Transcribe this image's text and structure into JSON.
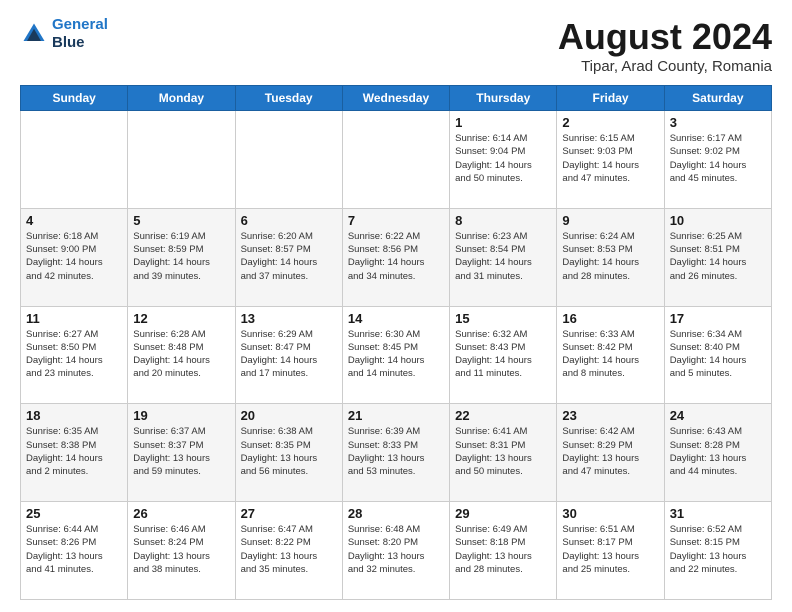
{
  "header": {
    "logo_line1": "General",
    "logo_line2": "Blue",
    "main_title": "August 2024",
    "subtitle": "Tipar, Arad County, Romania"
  },
  "weekdays": [
    "Sunday",
    "Monday",
    "Tuesday",
    "Wednesday",
    "Thursday",
    "Friday",
    "Saturday"
  ],
  "weeks": [
    [
      {
        "day": "",
        "info": ""
      },
      {
        "day": "",
        "info": ""
      },
      {
        "day": "",
        "info": ""
      },
      {
        "day": "",
        "info": ""
      },
      {
        "day": "1",
        "info": "Sunrise: 6:14 AM\nSunset: 9:04 PM\nDaylight: 14 hours\nand 50 minutes."
      },
      {
        "day": "2",
        "info": "Sunrise: 6:15 AM\nSunset: 9:03 PM\nDaylight: 14 hours\nand 47 minutes."
      },
      {
        "day": "3",
        "info": "Sunrise: 6:17 AM\nSunset: 9:02 PM\nDaylight: 14 hours\nand 45 minutes."
      }
    ],
    [
      {
        "day": "4",
        "info": "Sunrise: 6:18 AM\nSunset: 9:00 PM\nDaylight: 14 hours\nand 42 minutes."
      },
      {
        "day": "5",
        "info": "Sunrise: 6:19 AM\nSunset: 8:59 PM\nDaylight: 14 hours\nand 39 minutes."
      },
      {
        "day": "6",
        "info": "Sunrise: 6:20 AM\nSunset: 8:57 PM\nDaylight: 14 hours\nand 37 minutes."
      },
      {
        "day": "7",
        "info": "Sunrise: 6:22 AM\nSunset: 8:56 PM\nDaylight: 14 hours\nand 34 minutes."
      },
      {
        "day": "8",
        "info": "Sunrise: 6:23 AM\nSunset: 8:54 PM\nDaylight: 14 hours\nand 31 minutes."
      },
      {
        "day": "9",
        "info": "Sunrise: 6:24 AM\nSunset: 8:53 PM\nDaylight: 14 hours\nand 28 minutes."
      },
      {
        "day": "10",
        "info": "Sunrise: 6:25 AM\nSunset: 8:51 PM\nDaylight: 14 hours\nand 26 minutes."
      }
    ],
    [
      {
        "day": "11",
        "info": "Sunrise: 6:27 AM\nSunset: 8:50 PM\nDaylight: 14 hours\nand 23 minutes."
      },
      {
        "day": "12",
        "info": "Sunrise: 6:28 AM\nSunset: 8:48 PM\nDaylight: 14 hours\nand 20 minutes."
      },
      {
        "day": "13",
        "info": "Sunrise: 6:29 AM\nSunset: 8:47 PM\nDaylight: 14 hours\nand 17 minutes."
      },
      {
        "day": "14",
        "info": "Sunrise: 6:30 AM\nSunset: 8:45 PM\nDaylight: 14 hours\nand 14 minutes."
      },
      {
        "day": "15",
        "info": "Sunrise: 6:32 AM\nSunset: 8:43 PM\nDaylight: 14 hours\nand 11 minutes."
      },
      {
        "day": "16",
        "info": "Sunrise: 6:33 AM\nSunset: 8:42 PM\nDaylight: 14 hours\nand 8 minutes."
      },
      {
        "day": "17",
        "info": "Sunrise: 6:34 AM\nSunset: 8:40 PM\nDaylight: 14 hours\nand 5 minutes."
      }
    ],
    [
      {
        "day": "18",
        "info": "Sunrise: 6:35 AM\nSunset: 8:38 PM\nDaylight: 14 hours\nand 2 minutes."
      },
      {
        "day": "19",
        "info": "Sunrise: 6:37 AM\nSunset: 8:37 PM\nDaylight: 13 hours\nand 59 minutes."
      },
      {
        "day": "20",
        "info": "Sunrise: 6:38 AM\nSunset: 8:35 PM\nDaylight: 13 hours\nand 56 minutes."
      },
      {
        "day": "21",
        "info": "Sunrise: 6:39 AM\nSunset: 8:33 PM\nDaylight: 13 hours\nand 53 minutes."
      },
      {
        "day": "22",
        "info": "Sunrise: 6:41 AM\nSunset: 8:31 PM\nDaylight: 13 hours\nand 50 minutes."
      },
      {
        "day": "23",
        "info": "Sunrise: 6:42 AM\nSunset: 8:29 PM\nDaylight: 13 hours\nand 47 minutes."
      },
      {
        "day": "24",
        "info": "Sunrise: 6:43 AM\nSunset: 8:28 PM\nDaylight: 13 hours\nand 44 minutes."
      }
    ],
    [
      {
        "day": "25",
        "info": "Sunrise: 6:44 AM\nSunset: 8:26 PM\nDaylight: 13 hours\nand 41 minutes."
      },
      {
        "day": "26",
        "info": "Sunrise: 6:46 AM\nSunset: 8:24 PM\nDaylight: 13 hours\nand 38 minutes."
      },
      {
        "day": "27",
        "info": "Sunrise: 6:47 AM\nSunset: 8:22 PM\nDaylight: 13 hours\nand 35 minutes."
      },
      {
        "day": "28",
        "info": "Sunrise: 6:48 AM\nSunset: 8:20 PM\nDaylight: 13 hours\nand 32 minutes."
      },
      {
        "day": "29",
        "info": "Sunrise: 6:49 AM\nSunset: 8:18 PM\nDaylight: 13 hours\nand 28 minutes."
      },
      {
        "day": "30",
        "info": "Sunrise: 6:51 AM\nSunset: 8:17 PM\nDaylight: 13 hours\nand 25 minutes."
      },
      {
        "day": "31",
        "info": "Sunrise: 6:52 AM\nSunset: 8:15 PM\nDaylight: 13 hours\nand 22 minutes."
      }
    ]
  ]
}
